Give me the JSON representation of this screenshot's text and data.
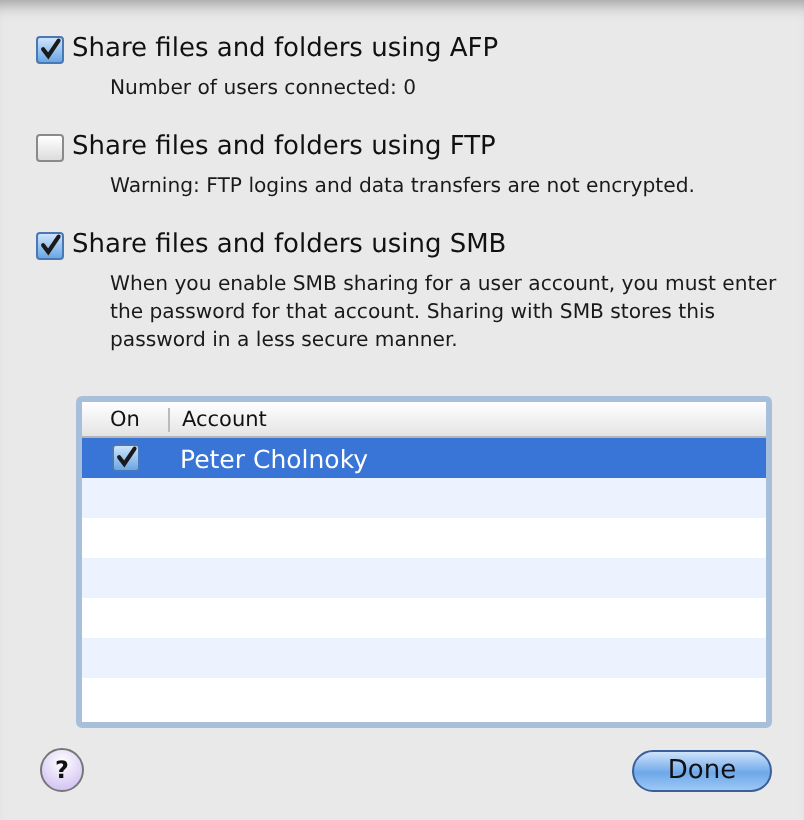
{
  "options": [
    {
      "label": "Share files and folders using AFP",
      "checked": true,
      "note": "Number of users connected: 0"
    },
    {
      "label": "Share files and folders using FTP",
      "checked": false,
      "note": "Warning: FTP logins and data transfers are not encrypted."
    },
    {
      "label": "Share files and folders using SMB",
      "checked": true,
      "note": "When you enable SMB sharing for a user account, you must enter the password for that account. Sharing with SMB stores this password in a less secure manner."
    }
  ],
  "table": {
    "columns": [
      "On",
      "Account"
    ],
    "rows": [
      {
        "on": true,
        "account": "Peter Cholnoky",
        "selected": true
      }
    ]
  },
  "help_button": "?",
  "buttons": [
    "Done"
  ]
}
